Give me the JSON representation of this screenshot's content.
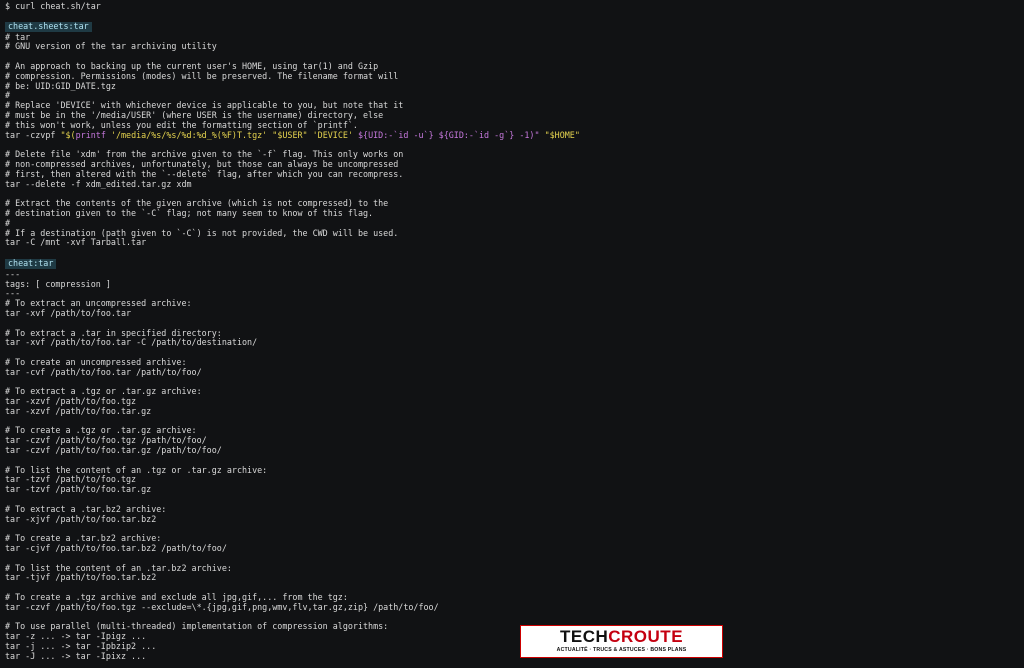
{
  "prompt": "$ curl cheat.sh/tar",
  "section1": {
    "header": "cheat.sheets:tar",
    "lines": [
      "# tar",
      "# GNU version of the tar archiving utility",
      "",
      "# An approach to backing up the current user's HOME, using tar(1) and Gzip",
      "# compression. Permissions (modes) will be preserved. The filename format will",
      "# be: UID:GID_DATE.tgz",
      "#",
      "# Replace 'DEVICE' with whichever device is applicable to you, but note that it",
      "# must be in the '/media/USER' (where USER is the username) directory, else",
      "# this won't work, unless you edit the formatting section of `printf`."
    ],
    "cmd_line": {
      "a": "tar -czvpf ",
      "b": "\"$(",
      "c": "printf",
      "d": " '/media/%s/%s/%d:%d_%(%F)T.tgz' ",
      "e": "\"$USER\"",
      "f": " 'DEVICE' ",
      "g": "${UID:-`id -u`} ${GID:-`id -g`} -1)\"",
      "h": " \"$HOME\""
    },
    "lines2": [
      "",
      "# Delete file 'xdm' from the archive given to the `-f` flag. This only works on",
      "# non-compressed archives, unfortunately, but those can always be uncompressed",
      "# first, then altered with the `--delete` flag, after which you can recompress.",
      "tar --delete -f xdm_edited.tar.gz xdm",
      "",
      "# Extract the contents of the given archive (which is not compressed) to the",
      "# destination given to the `-C` flag; not many seem to know of this flag.",
      "#",
      "# If a destination (path given to `-C`) is not provided, the CWD will be used.",
      "tar -C /mnt -xvf Tarball.tar",
      ""
    ]
  },
  "section2": {
    "header": "cheat:tar",
    "lines": [
      "---",
      "tags: [ compression ]",
      "---",
      "# To extract an uncompressed archive:",
      "tar -xvf /path/to/foo.tar",
      "",
      "# To extract a .tar in specified directory:",
      "tar -xvf /path/to/foo.tar -C /path/to/destination/",
      "",
      "# To create an uncompressed archive:",
      "tar -cvf /path/to/foo.tar /path/to/foo/",
      "",
      "# To extract a .tgz or .tar.gz archive:",
      "tar -xzvf /path/to/foo.tgz",
      "tar -xzvf /path/to/foo.tar.gz",
      "",
      "# To create a .tgz or .tar.gz archive:",
      "tar -czvf /path/to/foo.tgz /path/to/foo/",
      "tar -czvf /path/to/foo.tar.gz /path/to/foo/",
      "",
      "# To list the content of an .tgz or .tar.gz archive:",
      "tar -tzvf /path/to/foo.tgz",
      "tar -tzvf /path/to/foo.tar.gz",
      "",
      "# To extract a .tar.bz2 archive:",
      "tar -xjvf /path/to/foo.tar.bz2",
      "",
      "# To create a .tar.bz2 archive:",
      "tar -cjvf /path/to/foo.tar.bz2 /path/to/foo/",
      "",
      "# To list the content of an .tar.bz2 archive:",
      "tar -tjvf /path/to/foo.tar.bz2",
      "",
      "# To create a .tgz archive and exclude all jpg,gif,... from the tgz:",
      "tar -czvf /path/to/foo.tgz --exclude=\\*.{jpg,gif,png,wmv,flv,tar.gz,zip} /path/to/foo/",
      "",
      "# To use parallel (multi-threaded) implementation of compression algorithms:",
      "tar -z ... -> tar -Ipigz ...",
      "tar -j ... -> tar -Ipbzip2 ...",
      "tar -J ... -> tar -Ipixz ..."
    ]
  },
  "logo": {
    "brand_a": "TECH",
    "brand_b": "CROUTE",
    "tagline": "ACTUALITÉ · TRUCS & ASTUCES · BONS PLANS"
  },
  "colors": {
    "background": "#111214",
    "text": "#d9d9d9",
    "header_bg": "#1f3a44",
    "string_yellow": "#e5d34f",
    "keyword_purple": "#c678dd",
    "logo_red": "#c40010"
  }
}
